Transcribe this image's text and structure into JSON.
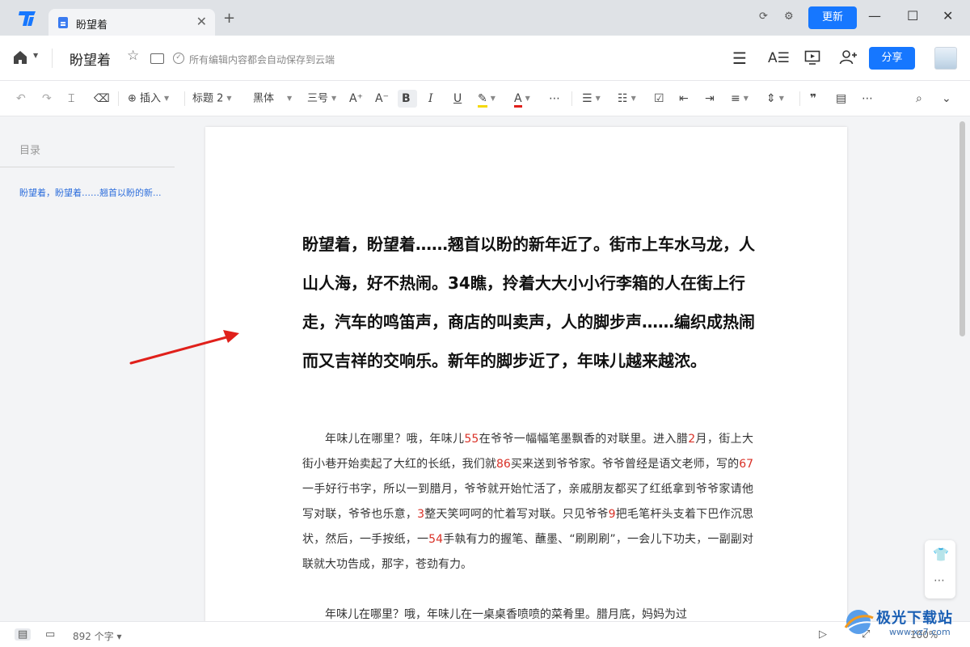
{
  "titlebar": {
    "tab_title": "盼望着",
    "tab_close": "✕",
    "tab_add": "+",
    "update_label": "更新",
    "accent": "#1677ff"
  },
  "header": {
    "doc_title": "盼望着",
    "save_status": "所有编辑内容都会自动保存到云端",
    "share_label": "分享"
  },
  "toolbar": {
    "insert_label": "插入",
    "heading_style": "标题 2",
    "font_family": "黑体",
    "font_size": "三号",
    "bold": "B",
    "italic": "I",
    "underline": "U",
    "font_color_letter": "A"
  },
  "sidebar": {
    "toc_title": "目录",
    "toc_items": [
      "盼望着，盼望着……翘首以盼的新..."
    ]
  },
  "document": {
    "heading": "盼望着，盼望着……翘首以盼的新年近了。街市上车水马龙，人山人海，好不热闹。34瞧，拎着大大小小行李箱的人在街上行走，汽车的鸣笛声，商店的叫卖声，人的脚步声……编织成热闹而又吉祥的交响乐。新年的脚步近了，年味儿越来越浓。",
    "p1": {
      "s1": "年味儿在哪里？哦，年味儿",
      "n1": "55",
      "s2": "在爷爷一幅幅笔墨飘香的对联里。进入腊",
      "n2": "2",
      "s3": "月，街上大街小巷开始卖起了大红的长纸，我们就",
      "n3": "86",
      "s4": "买来送到爷爷家。爷爷曾经是语文老师，写的",
      "n4": "67",
      "s5": "一手好行书字，所以一到腊月，爷爷就开始忙活了，亲戚朋友都买了红纸拿到爷爷家请他写对联，爷爷也乐意，",
      "n5": "3",
      "s6": "整天笑呵呵的忙着写对联。只见爷爷",
      "n6": "9",
      "s7": "把毛笔杆头支着下巴作沉思状，然后，一手按纸，一",
      "n7": "54",
      "s8": "手執有力的握笔、蘸墨、“刷刷刷”，一会儿下功夫，一副副对联就大功告成，那字，苍劲有力。"
    },
    "p2": "年味儿在哪里？哦，年味儿在一桌桌香喷喷的菜肴里。腊月底，妈妈为过"
  },
  "statusbar": {
    "word_count": "892 个字",
    "zoom": "100%"
  },
  "watermark": {
    "text": "极光下载站",
    "url": "www.xz7.com"
  }
}
